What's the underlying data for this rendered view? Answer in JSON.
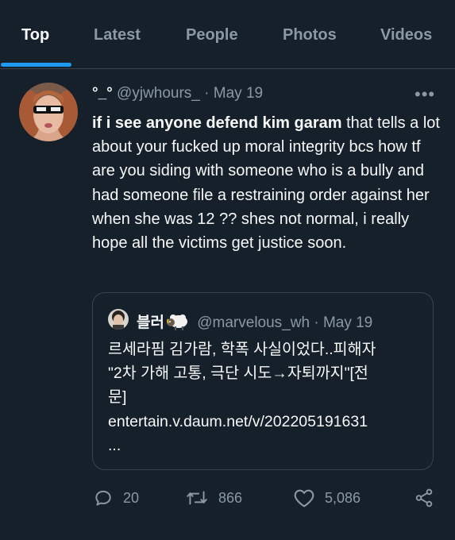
{
  "tabs": [
    {
      "label": "Top",
      "active": true
    },
    {
      "label": "Latest",
      "active": false
    },
    {
      "label": "People",
      "active": false
    },
    {
      "label": "Photos",
      "active": false
    },
    {
      "label": "Videos",
      "active": false
    }
  ],
  "tweet": {
    "display_name": "°_°",
    "handle": "@yjwhours_",
    "separator": "·",
    "date": "May 19",
    "text_bold": "if i see anyone defend kim garam",
    "text_rest": " that tells a lot about your fucked up moral integrity bcs how tf are you siding with someone who is a bully and had someone file a restraining order against her when she was 12 ?? shes not normal, i really hope all the victims get justice soon.",
    "quote": {
      "display_name": "블러",
      "emoji": "sheep-emoji",
      "handle": "@marvelous_wh",
      "separator": "·",
      "date": "May 19",
      "lines": [
        "르세라핌 김가람, 학폭 사실이었다..피해자",
        "\"2차 가해 고통, 극단 시도→자퇴까지\"[전",
        "문]",
        "entertain.v.daum.net/v/202205191631",
        "..."
      ]
    },
    "actions": {
      "reply_count": "20",
      "retweet_count": "866",
      "like_count": "5,086"
    }
  },
  "colors": {
    "background": "#15202b",
    "accent": "#1d9bf0",
    "muted_text": "#8b98a5",
    "border": "#38444d"
  }
}
